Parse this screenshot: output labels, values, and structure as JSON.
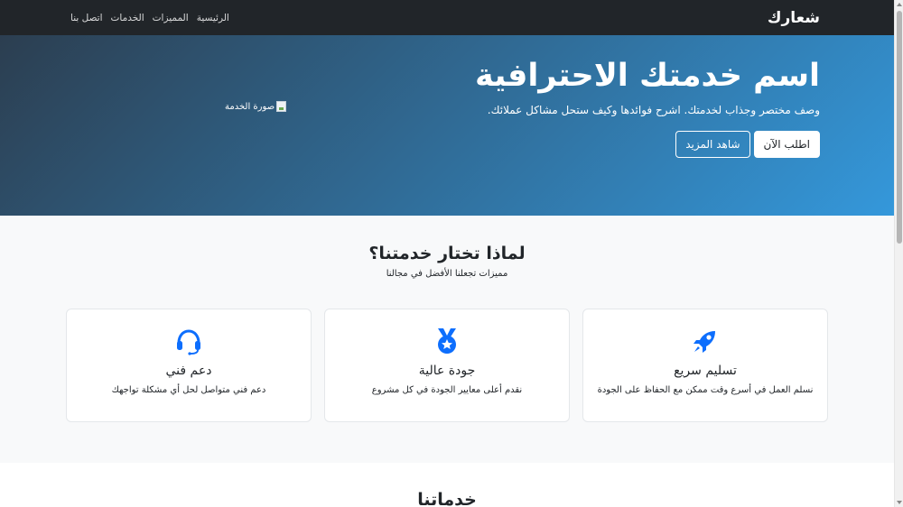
{
  "navbar": {
    "brand": "شعارك",
    "links": [
      "الرئيسية",
      "المميزات",
      "الخدمات",
      "اتصل بنا"
    ]
  },
  "hero": {
    "title": "اسم خدمتك الاحترافية",
    "description": "وصف مختصر وجذاب لخدمتك. اشرح فوائدها وكيف ستحل مشاكل عملائك.",
    "primary_button": "اطلب الآن",
    "secondary_button": "شاهد المزيد",
    "image_alt": "صورة الخدمة"
  },
  "features": {
    "title": "لماذا تختار خدمتنا؟",
    "subtitle": "مميزات تجعلنا الأفضل في مجالنا",
    "cards": [
      {
        "icon": "rocket-icon",
        "title": "تسليم سريع",
        "text": "نسلم العمل في أسرع وقت ممكن مع الحفاظ على الجودة"
      },
      {
        "icon": "medal-icon",
        "title": "جودة عالية",
        "text": "نقدم أعلى معايير الجودة في كل مشروع"
      },
      {
        "icon": "headset-icon",
        "title": "دعم فني",
        "text": "دعم فني متواصل لحل أي مشكلة تواجهك"
      }
    ]
  },
  "services": {
    "title": "خدماتنا"
  },
  "colors": {
    "navbar_bg": "#212529",
    "hero_gradient_start": "#2c3e50",
    "hero_gradient_end": "#3498db",
    "icon_accent": "#0d6efd"
  }
}
